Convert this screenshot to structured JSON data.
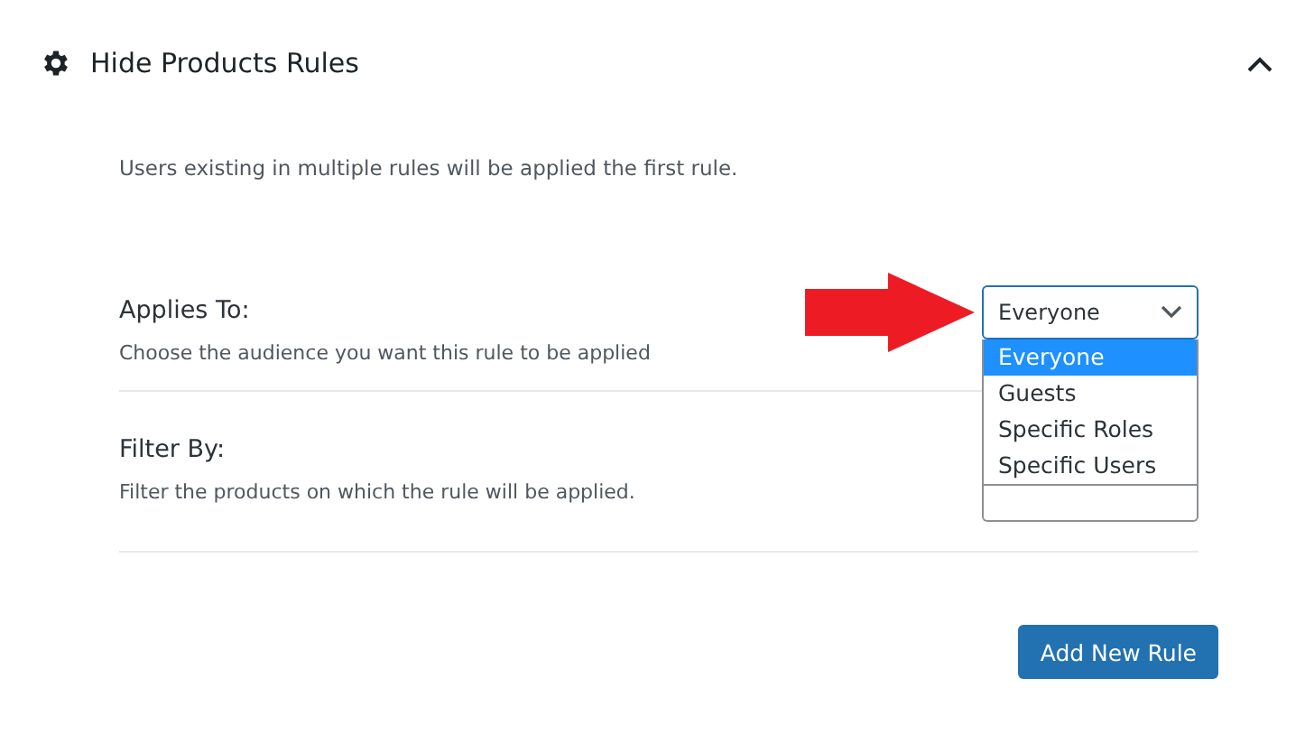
{
  "panel": {
    "title": "Hide Products Rules",
    "expanded": true
  },
  "notice": "Users existing in multiple rules will be applied the first rule.",
  "sections": [
    {
      "kind": "select",
      "title": "Applies To:",
      "description": "Choose the audience you want this rule to be applied",
      "value": "Everyone",
      "open": true,
      "options": [
        {
          "label": "Everyone",
          "selected": true
        },
        {
          "label": "Guests",
          "selected": false
        },
        {
          "label": "Specific Roles",
          "selected": false
        },
        {
          "label": "Specific Users",
          "selected": false
        }
      ]
    },
    {
      "kind": "plain",
      "title": "Filter By:",
      "description": "Filter the products on which the rule will be applied."
    }
  ],
  "button": "Add New Rule"
}
